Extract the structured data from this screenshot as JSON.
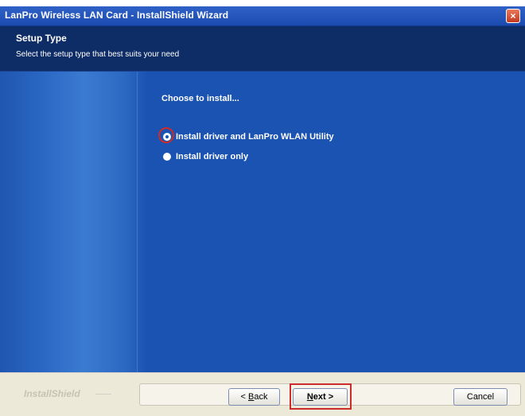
{
  "window": {
    "title": "LanPro Wireless LAN Card - InstallShield Wizard",
    "close_glyph": "×"
  },
  "header": {
    "title": "Setup Type",
    "subtitle": "Select the setup type that best suits your need"
  },
  "main": {
    "prompt": "Choose to install...",
    "options": [
      {
        "label": "Install driver and LanPro WLAN Utility",
        "selected": true
      },
      {
        "label": "Install driver only",
        "selected": false
      }
    ]
  },
  "footer": {
    "brand": "InstallShield",
    "buttons": {
      "back_prefix": "< ",
      "back_hotkey": "B",
      "back_rest": "ack",
      "next_hotkey": "N",
      "next_rest": "ext >",
      "cancel": "Cancel"
    }
  },
  "colors": {
    "titlebar": "#1c4bb0",
    "header": "#0e2c66",
    "content": "#1a53b2",
    "highlight": "#cc2b2b",
    "footer": "#ece9d8"
  },
  "icons": {
    "close": "close-icon",
    "radio_selected": "radio-selected-icon",
    "radio_unselected": "radio-unselected-icon"
  }
}
